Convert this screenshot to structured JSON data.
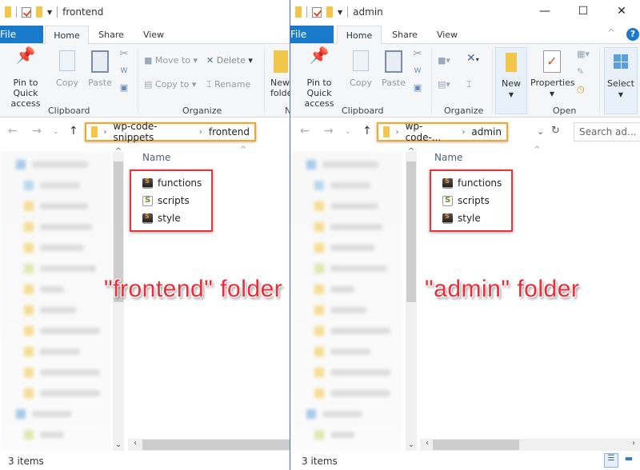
{
  "windows": [
    {
      "id": "frontend",
      "title": "frontend",
      "tabs": [
        "File",
        "Home",
        "Share",
        "View"
      ],
      "ribbon": {
        "clipboard": {
          "label": "Clipboard",
          "pin": "Pin to Quick access",
          "copy": "Copy",
          "paste": "Paste"
        },
        "organize": {
          "label": "Organize",
          "move_to": "Move to",
          "copy_to": "Copy to",
          "delete": "Delete",
          "rename": "Rename"
        },
        "new": {
          "label": "New",
          "new_folder": "New folder"
        }
      },
      "breadcrumb": [
        "wp-code-snippets",
        "frontend"
      ],
      "column_header": "Name",
      "files": [
        {
          "name": "functions",
          "icon": "sublime-file-icon"
        },
        {
          "name": "scripts",
          "icon": "script-file-icon"
        },
        {
          "name": "style",
          "icon": "sublime-file-icon"
        }
      ],
      "status": "3 items",
      "caption": "\"frontend\" folder"
    },
    {
      "id": "admin",
      "title": "admin",
      "tabs": [
        "File",
        "Home",
        "Share",
        "View"
      ],
      "ribbon": {
        "clipboard": {
          "label": "Clipboard",
          "pin": "Pin to Quick access",
          "copy": "Copy",
          "paste": "Paste"
        },
        "organize": {
          "label": "Organize"
        },
        "new": {
          "label": "New"
        },
        "open": {
          "label": "Open",
          "properties": "Properties"
        },
        "select": {
          "label": "Select"
        }
      },
      "breadcrumb": [
        "wp-code-...",
        "admin"
      ],
      "search_placeholder": "Search ad...",
      "column_header": "Name",
      "files": [
        {
          "name": "functions",
          "icon": "sublime-file-icon"
        },
        {
          "name": "scripts",
          "icon": "script-file-icon"
        },
        {
          "name": "style",
          "icon": "sublime-file-icon"
        }
      ],
      "status": "3 items",
      "caption": "\"admin\" folder"
    }
  ],
  "colors": {
    "file_tab": "#1979ca",
    "address_highlight": "#f5a623",
    "files_highlight": "#e8353b",
    "caption": "#ee2b36"
  }
}
